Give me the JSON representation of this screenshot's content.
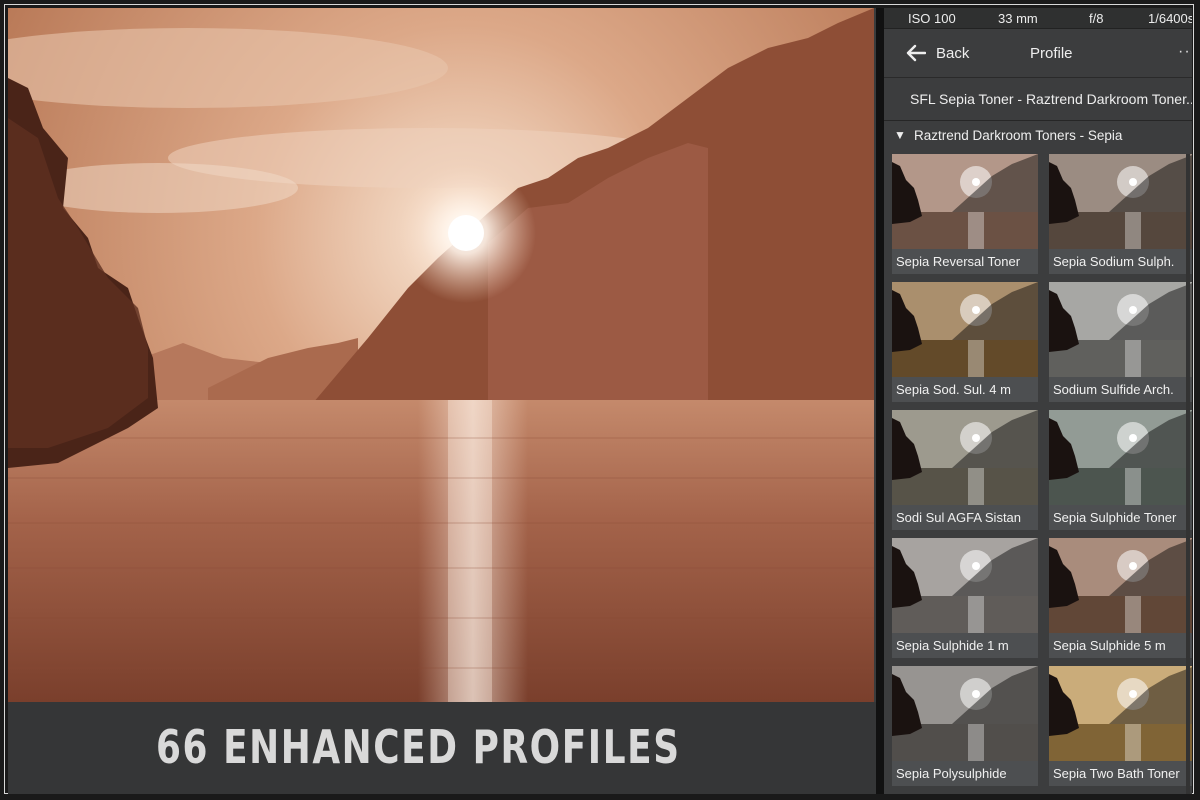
{
  "banner": {
    "text": "66 ENHANCED PROFILES"
  },
  "exif": {
    "iso": "ISO 100",
    "focal": "33 mm",
    "aperture": "f/8",
    "shutter": "1/6400s"
  },
  "header": {
    "back_label": "Back",
    "title": "Profile",
    "more": "···"
  },
  "selected_profile": "SFL Sepia Toner - Raztrend Darkroom Toner...",
  "group": {
    "label": "Raztrend Darkroom Toners - Sepia",
    "expanded": true
  },
  "icons": {
    "back": "arrow-left-icon",
    "more": "ellipsis-icon",
    "group": "triangle-down-icon"
  },
  "profiles": [
    {
      "name": "Sepia Reversal Toner",
      "tint": "#9a7562"
    },
    {
      "name": "Sepia Sodium Sulph.",
      "tint": "#7a6658"
    },
    {
      "name": "Sepia Sod. Sul. 4 m",
      "tint": "#8e6a3c"
    },
    {
      "name": "Sodium Sulfide Arch.",
      "tint": "#8a8a86"
    },
    {
      "name": "Sodi Sul AGFA Sistan",
      "tint": "#7d7868"
    },
    {
      "name": "Sepia Sulphide Toner",
      "tint": "#6e7a72"
    },
    {
      "name": "Sepia Sulphide 1 m",
      "tint": "#8a8580"
    },
    {
      "name": "Sepia Sulphide 5 m",
      "tint": "#8c6650"
    },
    {
      "name": "Sepia Polysulphide",
      "tint": "#74706c"
    },
    {
      "name": "Sepia Two Bath Toner",
      "tint": "#b8904e"
    }
  ]
}
